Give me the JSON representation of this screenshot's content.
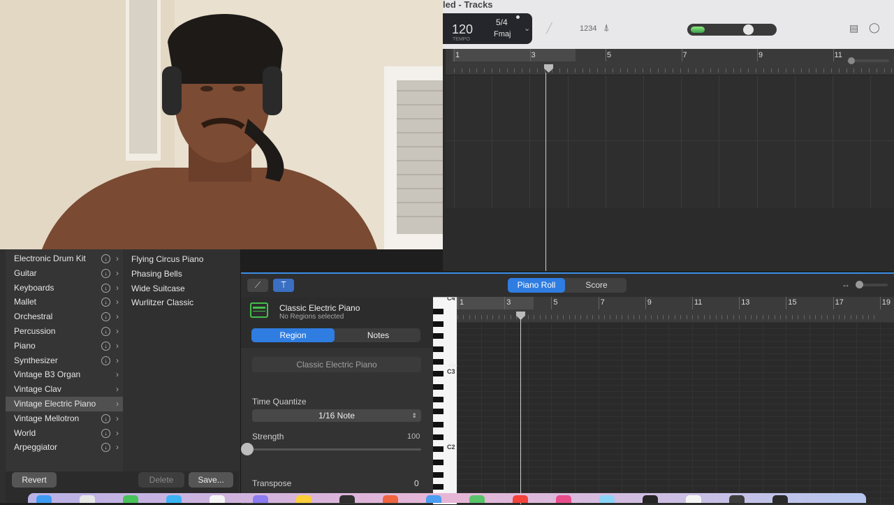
{
  "window": {
    "title": "led - Tracks"
  },
  "control_bar": {
    "tempo": "120",
    "tempo_label": "TEMPO",
    "time_signature": "5/4",
    "key": "Fmaj",
    "count_in": "1234",
    "master_volume": 0.68
  },
  "tracks_ruler": [
    "1",
    "3",
    "5",
    "7",
    "9",
    "11"
  ],
  "library": {
    "categories": [
      {
        "label": "Electronic Drum Kit",
        "download": true
      },
      {
        "label": "Guitar",
        "download": true
      },
      {
        "label": "Keyboards",
        "download": true
      },
      {
        "label": "Mallet",
        "download": true
      },
      {
        "label": "Orchestral",
        "download": true
      },
      {
        "label": "Percussion",
        "download": true
      },
      {
        "label": "Piano",
        "download": true
      },
      {
        "label": "Synthesizer",
        "download": true
      },
      {
        "label": "Vintage B3 Organ",
        "download": false
      },
      {
        "label": "Vintage Clav",
        "download": false
      },
      {
        "label": "Vintage Electric Piano",
        "download": false,
        "selected": true
      },
      {
        "label": "Vintage Mellotron",
        "download": true
      },
      {
        "label": "World",
        "download": true
      },
      {
        "label": "Arpeggiator",
        "download": true
      }
    ],
    "presets": [
      "Flying Circus Piano",
      "Phasing Bells",
      "Wide Suitcase",
      "Wurlitzer Classic"
    ],
    "revert_label": "Revert",
    "delete_label": "Delete",
    "save_label": "Save..."
  },
  "editor": {
    "tabs": [
      "Piano Roll",
      "Score"
    ],
    "region_name": "Classic Electric Piano",
    "region_status": "No Regions selected",
    "inspector_tabs": [
      "Region",
      "Notes"
    ],
    "region_field": "Classic Electric Piano",
    "time_quantize_label": "Time Quantize",
    "time_quantize_value": "1/16 Note",
    "strength_label": "Strength",
    "strength_value": "100",
    "transpose_label": "Transpose",
    "transpose_value": "0",
    "ruler": [
      "1",
      "3",
      "5",
      "7",
      "9",
      "11",
      "13",
      "15",
      "17",
      "19"
    ],
    "key_labels": [
      "C4",
      "C3",
      "C2"
    ]
  }
}
